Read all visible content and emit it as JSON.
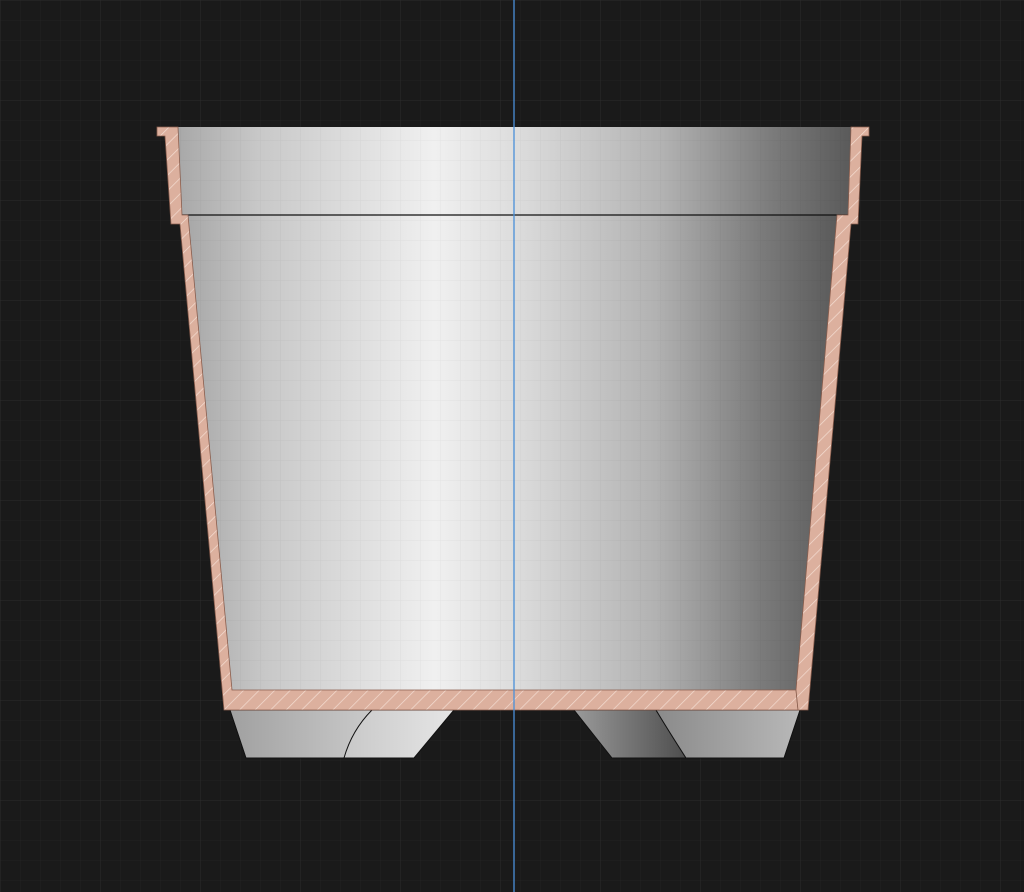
{
  "canvas": {
    "background_color": "#1a1a1a",
    "minor_grid_color": "#232323",
    "major_grid_color": "#2c2c2c",
    "grid_visible": true
  },
  "axis": {
    "type": "vertical-symmetry-axis",
    "color": "#4a90d9"
  },
  "model": {
    "object": "flower-pot",
    "view": "half-section",
    "section_side": "left",
    "feet_visible": 4,
    "colors": {
      "section_fill": "#dcb09e",
      "section_hatch": "#f4ddd2",
      "surface_highlight": "#f0f0f0",
      "surface_shadow": "#5a5a5a",
      "outline": "#111111"
    }
  }
}
